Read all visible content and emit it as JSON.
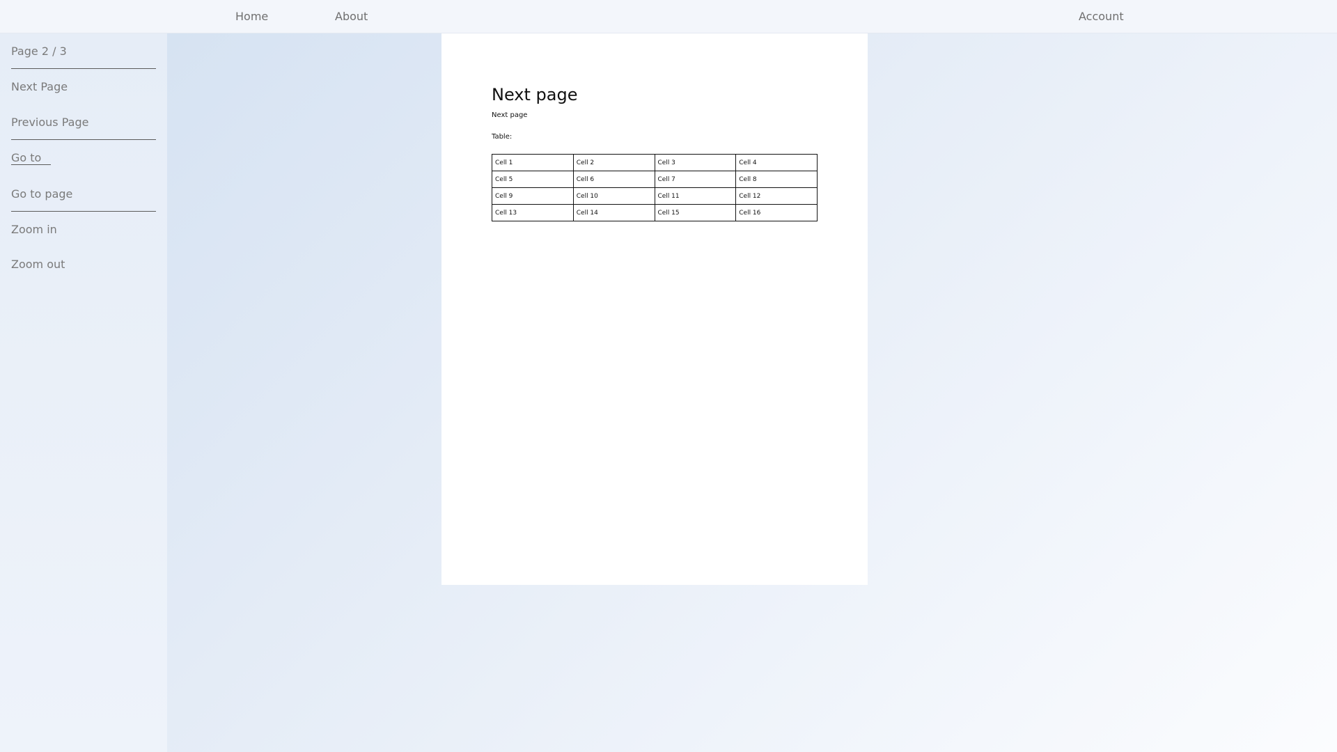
{
  "nav": {
    "home": "Home",
    "about": "About",
    "account": "Account"
  },
  "sidebar": {
    "page_indicator": "Page 2 / 3",
    "next_page": "Next Page",
    "previous_page": "Previous Page",
    "go_to": "Go to",
    "go_to_page": "Go to page",
    "zoom_in": "Zoom in",
    "zoom_out": "Zoom out"
  },
  "document": {
    "title": "Next page",
    "subtitle": "Next page",
    "table_label": "Table:",
    "table": [
      [
        "Cell 1",
        "Cell 2",
        "Cell 3",
        "Cell 4"
      ],
      [
        "Cell 5",
        "Cell 6",
        "Cell 7",
        "Cell 8"
      ],
      [
        "Cell 9",
        "Cell 10",
        "Cell 11",
        "Cell 12"
      ],
      [
        "Cell 13",
        "Cell 14",
        "Cell 15",
        "Cell 16"
      ]
    ]
  }
}
